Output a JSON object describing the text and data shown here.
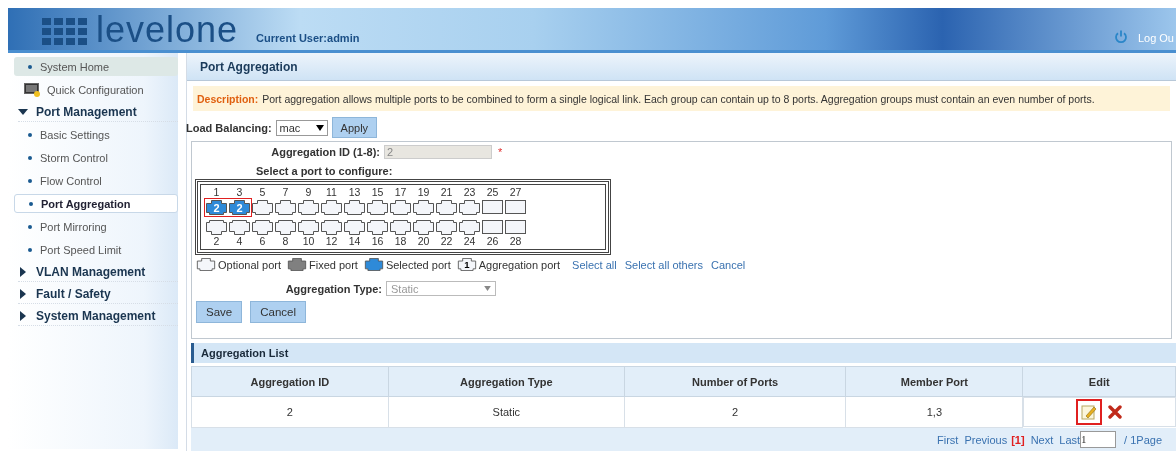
{
  "header": {
    "logo": "levelone",
    "current_user": "Current User:admin",
    "logout": "Log Ou"
  },
  "sidebar": {
    "items": [
      {
        "kind": "link",
        "label": "System Home",
        "shaded": true
      },
      {
        "kind": "shortcut",
        "label": "Quick Configuration"
      },
      {
        "kind": "group",
        "label": "Port Management",
        "expanded": true,
        "children": [
          {
            "label": "Basic Settings",
            "selected": false
          },
          {
            "label": "Storm Control",
            "selected": false
          },
          {
            "label": "Flow Control",
            "selected": false
          },
          {
            "label": "Port Aggregation",
            "selected": true
          },
          {
            "label": "Port Mirroring",
            "selected": false
          },
          {
            "label": "Port Speed Limit",
            "selected": false
          }
        ]
      },
      {
        "kind": "group",
        "label": "VLAN Management",
        "expanded": false
      },
      {
        "kind": "group",
        "label": "Fault / Safety",
        "expanded": false
      },
      {
        "kind": "group",
        "label": "System Management",
        "expanded": false
      }
    ]
  },
  "page_title": "Port Aggregation",
  "description": {
    "label": "Description:",
    "text": "Port aggregation allows multiple ports to be combined to form a single logical link. Each group can contain up to 8 ports. Aggregation groups must contain an even number of ports."
  },
  "load_balancing": {
    "label": "Load Balancing:",
    "value": "mac",
    "button": "Apply"
  },
  "form": {
    "id_label": "Aggregation ID (1-8):",
    "id_value": "2",
    "required_mark": "*",
    "ports_label": "Select a port to configure:",
    "ports": [
      {
        "number": "1",
        "kind": "copper",
        "selected": true,
        "group": "2",
        "highlighted": true
      },
      {
        "number": "2",
        "kind": "copper",
        "selected": false
      },
      {
        "number": "3",
        "kind": "copper",
        "selected": true,
        "group": "2",
        "highlighted": true
      },
      {
        "number": "4",
        "kind": "copper",
        "selected": false
      },
      {
        "number": "5",
        "kind": "copper",
        "selected": false
      },
      {
        "number": "6",
        "kind": "copper",
        "selected": false
      },
      {
        "number": "7",
        "kind": "copper",
        "selected": false
      },
      {
        "number": "8",
        "kind": "copper",
        "selected": false
      },
      {
        "number": "9",
        "kind": "copper",
        "selected": false
      },
      {
        "number": "10",
        "kind": "copper",
        "selected": false
      },
      {
        "number": "11",
        "kind": "copper",
        "selected": false
      },
      {
        "number": "12",
        "kind": "copper",
        "selected": false
      },
      {
        "number": "13",
        "kind": "copper",
        "selected": false
      },
      {
        "number": "14",
        "kind": "copper",
        "selected": false
      },
      {
        "number": "15",
        "kind": "copper",
        "selected": false
      },
      {
        "number": "16",
        "kind": "copper",
        "selected": false
      },
      {
        "number": "17",
        "kind": "copper",
        "selected": false
      },
      {
        "number": "18",
        "kind": "copper",
        "selected": false
      },
      {
        "number": "19",
        "kind": "copper",
        "selected": false
      },
      {
        "number": "20",
        "kind": "copper",
        "selected": false
      },
      {
        "number": "21",
        "kind": "copper",
        "selected": false
      },
      {
        "number": "22",
        "kind": "copper",
        "selected": false
      },
      {
        "number": "23",
        "kind": "copper",
        "selected": false
      },
      {
        "number": "24",
        "kind": "copper",
        "selected": false
      },
      {
        "number": "25",
        "kind": "fiber",
        "selected": false
      },
      {
        "number": "26",
        "kind": "fiber",
        "selected": false
      },
      {
        "number": "27",
        "kind": "fiber",
        "selected": false
      },
      {
        "number": "28",
        "kind": "fiber",
        "selected": false
      }
    ],
    "legend": [
      {
        "kind": "optional",
        "label": "Optional port"
      },
      {
        "kind": "fixed",
        "label": "Fixed port"
      },
      {
        "kind": "selected",
        "label": "Selected port"
      },
      {
        "kind": "aggregation",
        "label": "Aggregation port",
        "mark": "1"
      }
    ],
    "links": [
      "Select all",
      "Select all others",
      "Cancel"
    ],
    "type_label": "Aggregation Type:",
    "type_value": "Static",
    "buttons": [
      "Save",
      "Cancel"
    ]
  },
  "list": {
    "title": "Aggregation List",
    "columns": [
      "Aggregation ID",
      "Aggregation Type",
      "Number of Ports",
      "Member Port",
      "Edit"
    ],
    "rows": [
      {
        "cells": [
          "2",
          "Static",
          "2",
          "1,3"
        ],
        "edit_highlighted": true
      }
    ]
  },
  "pager": {
    "first": "First",
    "previous": "Previous",
    "current": "[1]",
    "next": "Next",
    "last": "Last",
    "page_value": "1",
    "total": "/ 1Page"
  }
}
